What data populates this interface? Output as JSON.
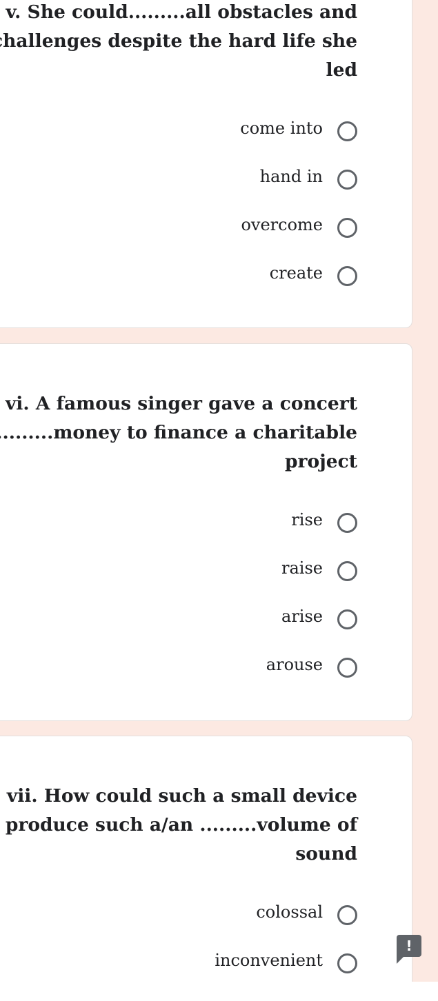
{
  "questions": [
    {
      "lines": [
        "v. She could.........all obstacles and",
        "challenges despite the hard life she",
        "led"
      ],
      "required": false,
      "options": [
        "come into",
        "hand in",
        "overcome",
        "create"
      ]
    },
    {
      "lines": [
        "vi. A famous singer gave a concert",
        "to...........money to finance a charitable",
        "project"
      ],
      "required": true,
      "required_mark": "*",
      "options": [
        "rise",
        "raise",
        "arise",
        "arouse"
      ]
    },
    {
      "lines": [
        "vii. How could such a small device",
        "produce such a/an .........volume of",
        "sound"
      ],
      "required": true,
      "required_mark": "*",
      "options": [
        "colossal",
        "inconvenient"
      ]
    }
  ],
  "report_button": {
    "icon": "exclamation-icon",
    "glyph": "!"
  },
  "colors": {
    "background": "#fce9e2",
    "card": "#ffffff",
    "text": "#202124",
    "radio": "#5f6368",
    "required": "#d93025"
  }
}
